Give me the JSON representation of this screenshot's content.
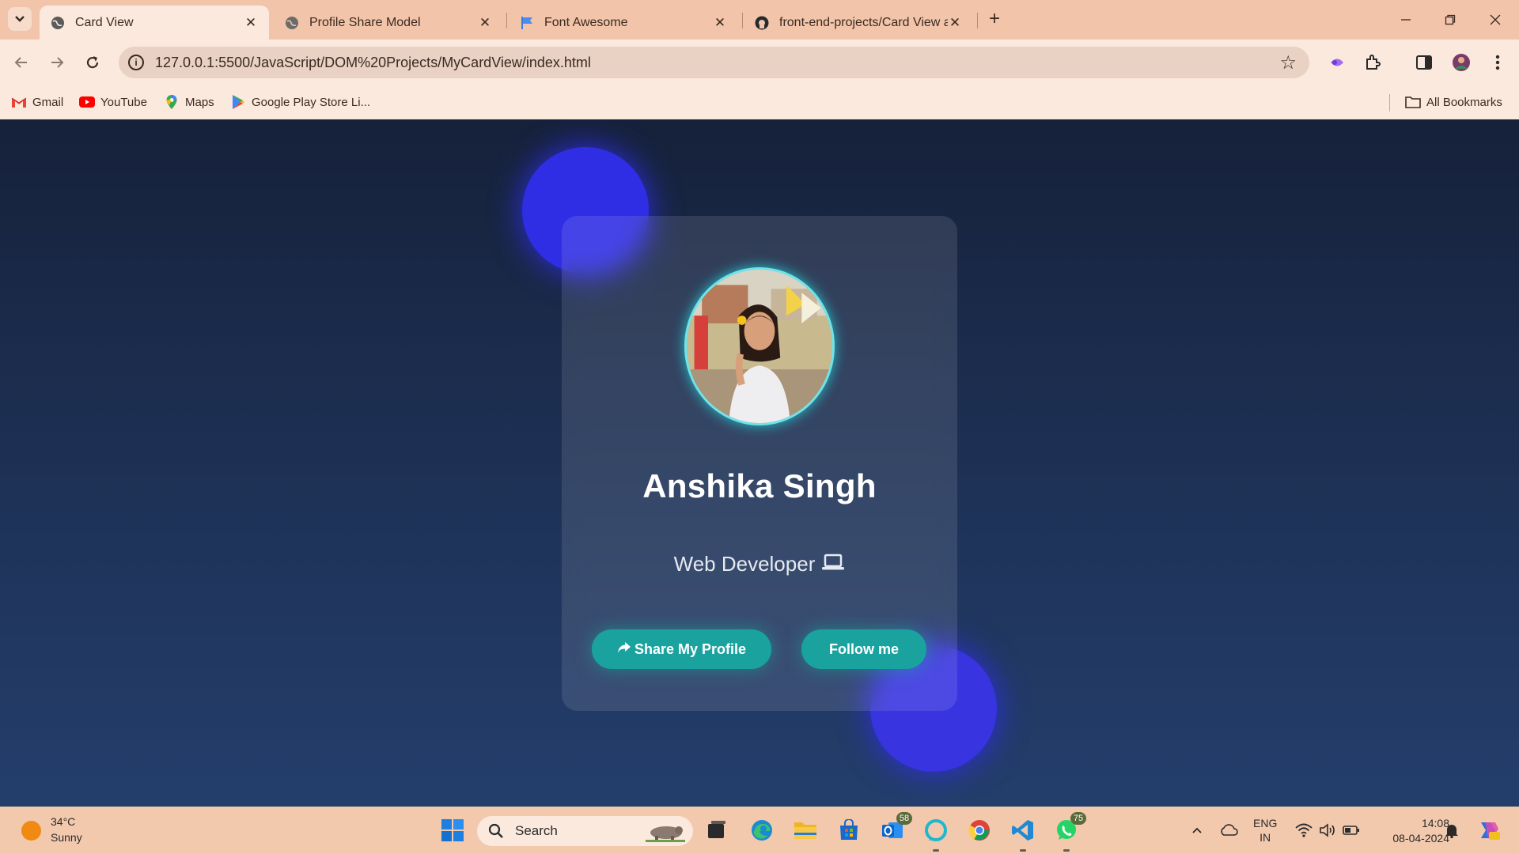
{
  "browser": {
    "tabs": [
      {
        "title": "Card View",
        "active": true
      },
      {
        "title": "Profile Share Model",
        "active": false
      },
      {
        "title": "Font Awesome",
        "active": false
      },
      {
        "title": "front-end-projects/Card View a",
        "active": false
      }
    ],
    "url": "127.0.0.1:5500/JavaScript/DOM%20Projects/MyCardView/index.html",
    "bookmarks": [
      {
        "label": "Gmail",
        "icon": "gmail-icon"
      },
      {
        "label": "YouTube",
        "icon": "youtube-icon"
      },
      {
        "label": "Maps",
        "icon": "maps-icon"
      },
      {
        "label": "Google Play Store Li...",
        "icon": "play-store-icon"
      }
    ],
    "all_bookmarks_label": "All Bookmarks"
  },
  "card": {
    "name": "Anshika Singh",
    "role": "Web Developer",
    "role_icon": "laptop-icon",
    "share_label": "Share My Profile",
    "follow_label": "Follow me"
  },
  "taskbar": {
    "weather_temp": "34°C",
    "weather_desc": "Sunny",
    "search_label": "Search",
    "badges": {
      "outlook": "58",
      "whatsapp": "75"
    },
    "lang_top": "ENG",
    "lang_bottom": "IN",
    "time": "14:08",
    "date": "08-04-2024"
  },
  "colors": {
    "accent_button": "#1aa39e",
    "avatar_ring": "#6fe3ea",
    "blob": "#2f2ee5",
    "tabstrip": "#f2c4a9"
  }
}
